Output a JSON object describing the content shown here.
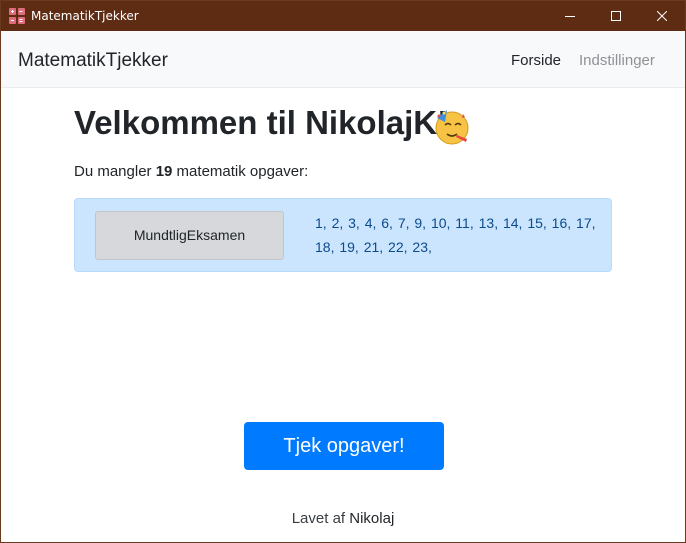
{
  "window": {
    "title": "MatematikTjekker",
    "controls": [
      "minimize-icon",
      "maximize-icon",
      "close-icon"
    ]
  },
  "navbar": {
    "brand": "MatematikTjekker",
    "links": {
      "home": "Forside",
      "settings": "Indstillinger"
    }
  },
  "main": {
    "welcome": "Velkommen til NikolajK!",
    "welcome_emoji": "partying-face-icon",
    "subtitle_prefix": "Du mangler ",
    "missing_count": "19",
    "subtitle_suffix": " matematik opgaver:",
    "exam": {
      "button_label": "MundtligEksamen",
      "tasks": "1, 2, 3, 4, 6, 7, 9, 10, 11, 13, 14, 15, 16, 17, 18, 19, 21, 22, 23,"
    },
    "check_button": "Tjek opgaver!"
  },
  "footer": {
    "prefix": "Lavet af ",
    "author": "Nikolaj"
  },
  "colors": {
    "titlebar": "#5e2b13",
    "primary": "#007bff",
    "alert_bg": "#cce5ff",
    "alert_border": "#b8daff",
    "exam_button_bg": "#d6d8db",
    "task_text": "#0b4b8a"
  }
}
